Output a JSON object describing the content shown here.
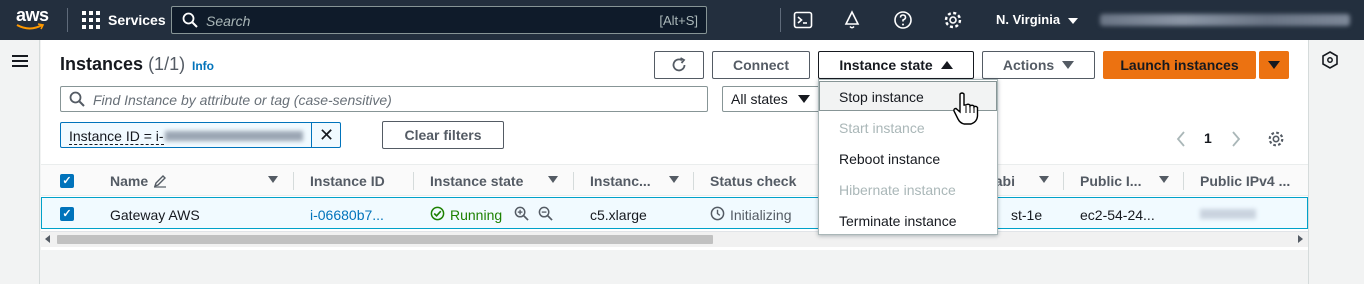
{
  "topbar": {
    "logo_text": "aws",
    "services_label": "Services",
    "search_placeholder": "Search",
    "search_shortcut": "[Alt+S]",
    "region": "N. Virginia"
  },
  "header": {
    "title": "Instances",
    "count": "(1/1)",
    "info_link": "Info",
    "buttons": {
      "connect": "Connect",
      "instance_state": "Instance state",
      "actions": "Actions",
      "launch": "Launch instances"
    }
  },
  "filters": {
    "search_placeholder": "Find Instance by attribute or tag (case-sensitive)",
    "states_select": "All states",
    "token_label": "Instance ID = i-",
    "clear_filters": "Clear filters"
  },
  "pagination": {
    "current_page": "1"
  },
  "table": {
    "columns": [
      "Name",
      "Instance ID",
      "Instance state",
      "Instanc...",
      "Status check",
      "Availabi...",
      "Public I...",
      "Public IPv4 ..."
    ],
    "row": {
      "name": "Gateway AWS",
      "instance_id": "i-06680b7...",
      "state": "Running",
      "type": "c5.xlarge",
      "status_check": "Initializing",
      "az": "st-1e",
      "public_dns": "ec2-54-24..."
    }
  },
  "instance_state_menu": {
    "items": [
      {
        "label": "Stop instance",
        "enabled": true,
        "hovered": true
      },
      {
        "label": "Start instance",
        "enabled": false
      },
      {
        "label": "Reboot instance",
        "enabled": true
      },
      {
        "label": "Hibernate instance",
        "enabled": false
      },
      {
        "label": "Terminate instance",
        "enabled": true
      }
    ]
  },
  "colors": {
    "topbar_bg": "#232f3e",
    "primary_orange": "#ec7211",
    "link_blue": "#0073bb",
    "running_green": "#1d8102",
    "disabled_gray": "#aab7b8"
  }
}
